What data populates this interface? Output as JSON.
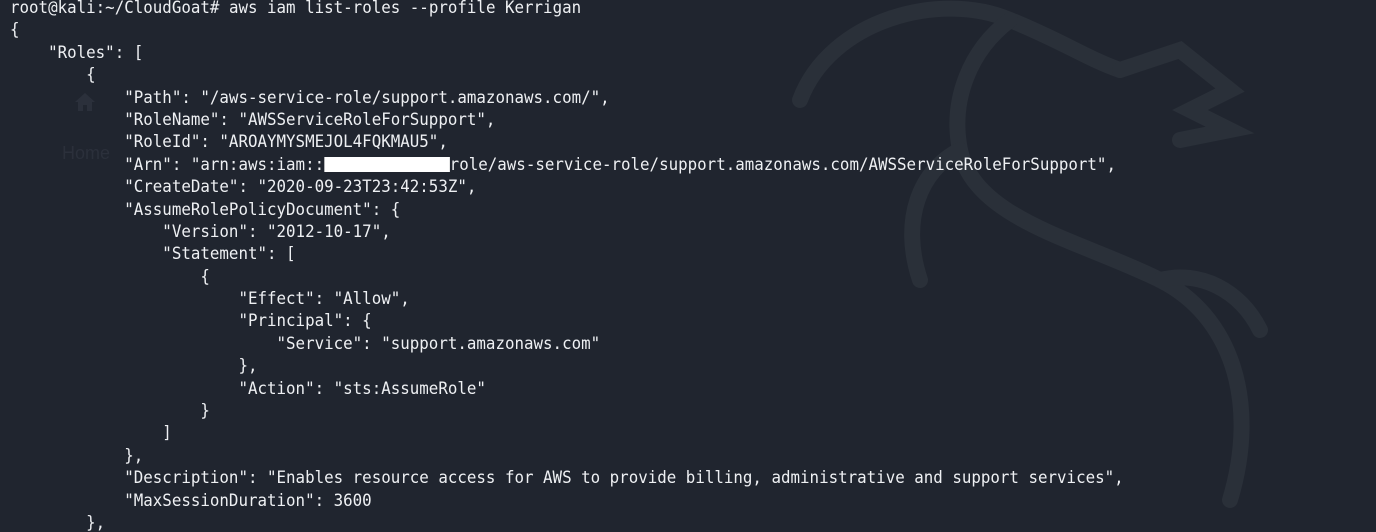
{
  "terminal": {
    "prompt": "root@kali:~/CloudGoat#",
    "command": "aws iam list-roles --profile Kerrigan",
    "lines": [
      "{",
      "    \"Roles\": [",
      "        {",
      "            \"Path\": \"/aws-service-role/support.amazonaws.com/\",",
      "            \"RoleName\": \"AWSServiceRoleForSupport\",",
      "            \"RoleId\": \"AROAYMYSMEJOL4FQKMAU5\",",
      "            \"Arn\": \"arn:aws:iam::",
      "            \"CreateDate\": \"2020-09-23T23:42:53Z\",",
      "            \"AssumeRolePolicyDocument\": {",
      "                \"Version\": \"2012-10-17\",",
      "                \"Statement\": [",
      "                    {",
      "                        \"Effect\": \"Allow\",",
      "                        \"Principal\": {",
      "                            \"Service\": \"support.amazonaws.com\"",
      "                        },",
      "                        \"Action\": \"sts:AssumeRole\"",
      "                    }",
      "                ]",
      "            },",
      "            \"Description\": \"Enables resource access for AWS to provide billing, administrative and support services\",",
      "            \"MaxSessionDuration\": 3600",
      "        },"
    ],
    "arn_suffix": "role/aws-service-role/support.amazonaws.com/AWSServiceRoleForSupport\","
  },
  "background": {
    "ghost_label": "Home",
    "watermark_icon": "kali-dragon-icon",
    "ghost_icon": "home-icon"
  },
  "colors": {
    "background": "#20252f",
    "text": "#eef0f3",
    "redaction": "#ffffff"
  }
}
